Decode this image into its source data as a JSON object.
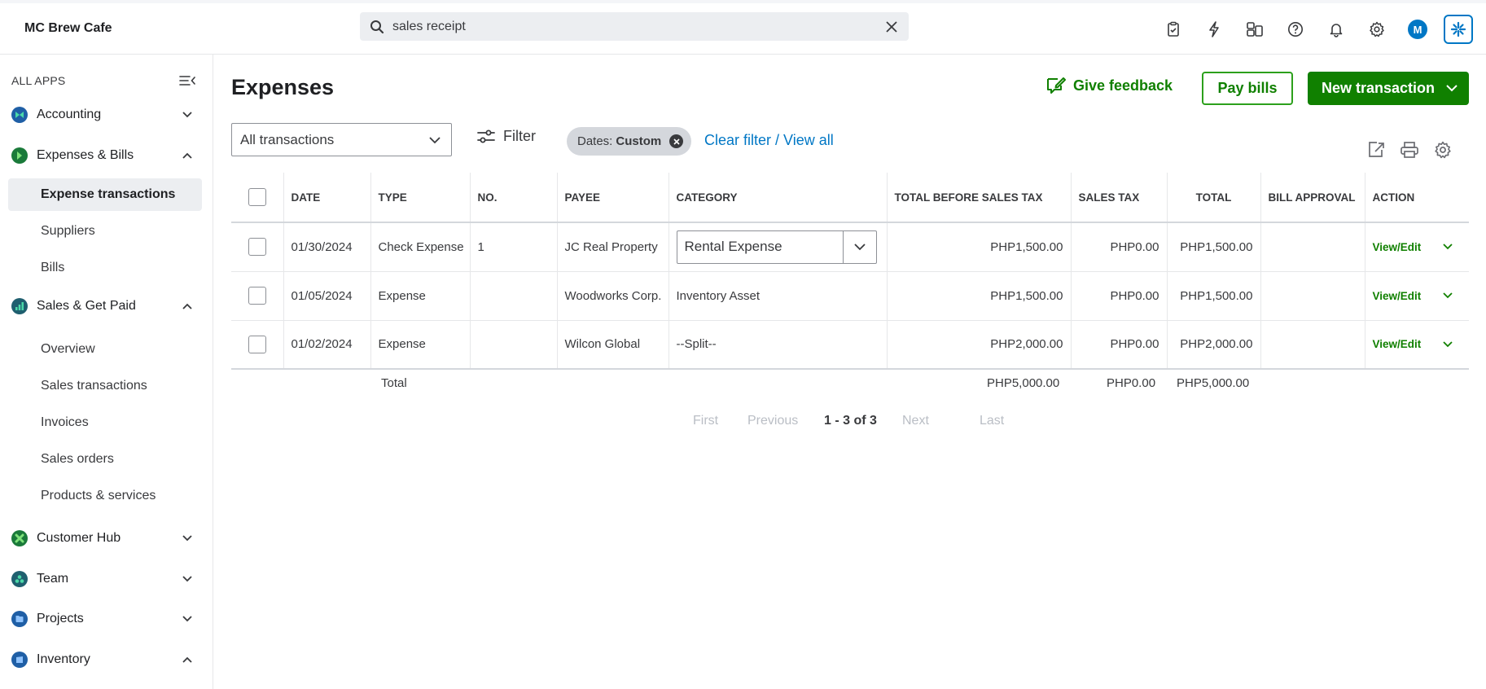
{
  "header": {
    "company": "MC Brew Cafe",
    "search": {
      "value": "sales receipt",
      "placeholder": ""
    },
    "avatar_initial": "M"
  },
  "sidebar": {
    "all_apps_label": "ALL APPS",
    "sections": [
      {
        "label": "Accounting",
        "icon": "accounting-icon",
        "color": "#1f5fa6",
        "expanded": false
      },
      {
        "label": "Expenses & Bills",
        "icon": "expenses-icon",
        "color": "#1a7a3a",
        "expanded": true,
        "items": [
          {
            "label": "Expense transactions",
            "active": true
          },
          {
            "label": "Suppliers",
            "active": false
          },
          {
            "label": "Bills",
            "active": false
          }
        ]
      },
      {
        "label": "Sales & Get Paid",
        "icon": "sales-icon",
        "color": "#1f5f6f",
        "expanded": true,
        "items": [
          {
            "label": "Overview"
          },
          {
            "label": "Sales transactions"
          },
          {
            "label": "Invoices"
          },
          {
            "label": "Sales orders"
          },
          {
            "label": "Products & services"
          }
        ]
      },
      {
        "label": "Customer Hub",
        "icon": "customer-hub-icon",
        "color": "#2ca01c",
        "expanded": false
      },
      {
        "label": "Team",
        "icon": "team-icon",
        "color": "#1f5f6f",
        "expanded": false
      },
      {
        "label": "Projects",
        "icon": "projects-icon",
        "color": "#1f5fa6",
        "expanded": false
      },
      {
        "label": "Inventory",
        "icon": "inventory-icon",
        "color": "#1f5fa6",
        "expanded": true
      }
    ]
  },
  "main": {
    "title": "Expenses",
    "feedback_label": "Give feedback",
    "pay_bills_label": "Pay bills",
    "new_transaction_label": "New transaction",
    "filter_dropdown_value": "All transactions",
    "filter_label": "Filter",
    "chip": {
      "key": "Dates:",
      "value": "Custom"
    },
    "clear_filter_label": "Clear filter / View all"
  },
  "table": {
    "columns": [
      "DATE",
      "TYPE",
      "NO.",
      "PAYEE",
      "CATEGORY",
      "TOTAL BEFORE SALES TAX",
      "SALES TAX",
      "TOTAL",
      "BILL APPROVAL",
      "ACTION"
    ],
    "rows": [
      {
        "date": "01/30/2024",
        "type": "Check Expense",
        "no": "1",
        "payee": "JC Real Property",
        "category": "Rental Expense",
        "category_editable": true,
        "before_tax": "PHP1,500.00",
        "sales_tax": "PHP0.00",
        "total": "PHP1,500.00",
        "approval": "",
        "action": "View/Edit"
      },
      {
        "date": "01/05/2024",
        "type": "Expense",
        "no": "",
        "payee": "Woodworks Corp.",
        "category": "Inventory Asset",
        "category_editable": false,
        "before_tax": "PHP1,500.00",
        "sales_tax": "PHP0.00",
        "total": "PHP1,500.00",
        "approval": "",
        "action": "View/Edit"
      },
      {
        "date": "01/02/2024",
        "type": "Expense",
        "no": "",
        "payee": "Wilcon Global",
        "category": "--Split--",
        "category_editable": false,
        "before_tax": "PHP2,000.00",
        "sales_tax": "PHP0.00",
        "total": "PHP2,000.00",
        "approval": "",
        "action": "View/Edit"
      }
    ],
    "totals": {
      "label": "Total",
      "before_tax": "PHP5,000.00",
      "sales_tax": "PHP0.00",
      "total": "PHP5,000.00"
    }
  },
  "pager": {
    "first": "First",
    "previous": "Previous",
    "range": "1 - 3 of 3",
    "next": "Next",
    "last": "Last"
  },
  "colors": {
    "brand_green": "#108000",
    "link_blue": "#0077c5"
  }
}
